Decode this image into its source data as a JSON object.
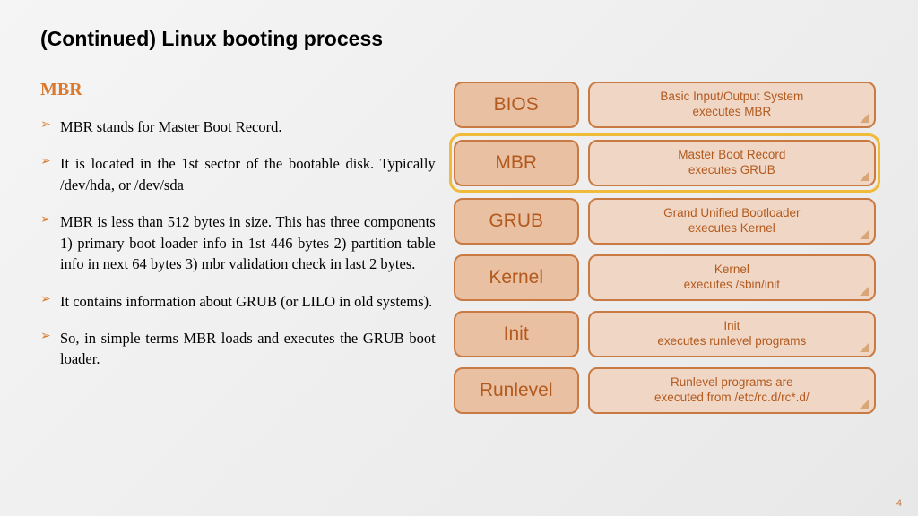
{
  "title": "(Continued) Linux booting process",
  "section_heading": "MBR",
  "bullets": [
    "MBR stands for Master Boot Record.",
    "It is located in the 1st sector of the bootable disk. Typically /dev/hda, or /dev/sda",
    "MBR is less than 512 bytes in size. This has three components 1) primary boot loader info in 1st 446 bytes 2) partition table info in next 64 bytes 3) mbr validation check in last 2 bytes.",
    "It contains information about GRUB (or LILO in old systems).",
    "So, in simple terms MBR loads and executes the GRUB boot loader."
  ],
  "stages": [
    {
      "label": "BIOS",
      "desc": "Basic Input/Output System\nexecutes MBR",
      "highlight": false
    },
    {
      "label": "MBR",
      "desc": "Master Boot Record\nexecutes GRUB",
      "highlight": true
    },
    {
      "label": "GRUB",
      "desc": "Grand Unified Bootloader\nexecutes Kernel",
      "highlight": false
    },
    {
      "label": "Kernel",
      "desc": "Kernel\nexecutes /sbin/init",
      "highlight": false
    },
    {
      "label": "Init",
      "desc": "Init\nexecutes runlevel programs",
      "highlight": false
    },
    {
      "label": "Runlevel",
      "desc": "Runlevel programs are\nexecuted from /etc/rc.d/rc*.d/",
      "highlight": false
    }
  ],
  "page_number": "4"
}
